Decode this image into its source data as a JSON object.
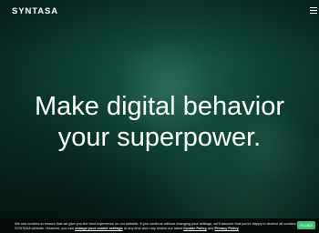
{
  "header": {
    "logo_text": "SYNTASA",
    "menu_icon": "hamburger-menu-icon"
  },
  "hero": {
    "headline_line1": "Make digital behavior",
    "headline_line2": "your superpower."
  },
  "cookie_banner": {
    "text_part1": "We use cookies to ensure that we give you the best experience on our website. If you continue without changing your settings, we'll assume that you're happy to receive all cookies on the",
    "text_part2": "SYNTASA website. However, you can ",
    "link_change_settings": "change your cookie settings",
    "text_part3": " at any time and may review our latest ",
    "link_cookie_policy": "Cookie Policy",
    "text_part4": " and ",
    "link_privacy_policy": "Privacy Policy",
    "text_part5": ".",
    "accept_label": "Accept"
  },
  "colors": {
    "background": "#0f4235",
    "cookie_bar": "#050b0a",
    "accept_button": "#3fbf73",
    "text": "#ffffff"
  }
}
